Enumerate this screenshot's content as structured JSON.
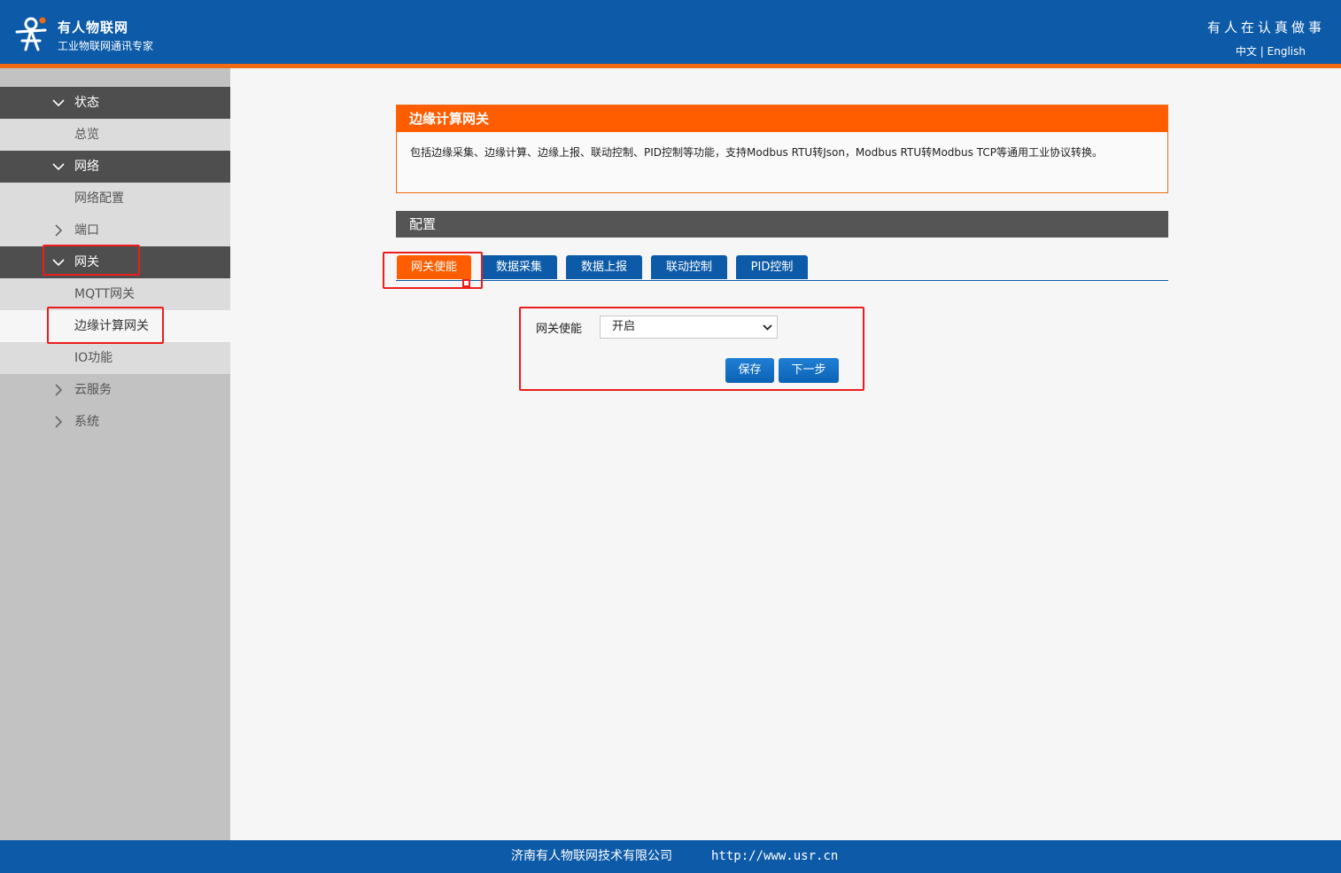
{
  "header": {
    "brand_name": "有人物联网",
    "brand_sub": "工业物联网通讯专家",
    "slogan": "有人在认真做事",
    "lang_cn": "中文",
    "lang_sep": " | ",
    "lang_en": "English"
  },
  "sidebar": {
    "items": [
      {
        "label": "状态",
        "type": "parent",
        "expanded": true
      },
      {
        "label": "总览",
        "type": "child"
      },
      {
        "label": "网络",
        "type": "parent",
        "expanded": true
      },
      {
        "label": "网络配置",
        "type": "child"
      },
      {
        "label": "端口",
        "type": "collapsed"
      },
      {
        "label": "网关",
        "type": "parent",
        "expanded": true
      },
      {
        "label": "MQTT网关",
        "type": "child"
      },
      {
        "label": "边缘计算网关",
        "type": "child",
        "active": true
      },
      {
        "label": "IO功能",
        "type": "child"
      },
      {
        "label": "云服务",
        "type": "collapsed"
      },
      {
        "label": "系统",
        "type": "collapsed"
      }
    ]
  },
  "main": {
    "intro_title": "边缘计算网关",
    "intro_text": "包括边缘采集、边缘计算、边缘上报、联动控制、PID控制等功能，支持Modbus RTU转Json，Modbus RTU转Modbus TCP等通用工业协议转换。",
    "config_title": "配置",
    "tabs": [
      {
        "label": "网关使能",
        "active": true
      },
      {
        "label": "数据采集"
      },
      {
        "label": "数据上报"
      },
      {
        "label": "联动控制"
      },
      {
        "label": "PID控制"
      }
    ],
    "gateway_enable_label": "网关使能",
    "gateway_enable_value": "开启",
    "save_label": "保存",
    "next_label": "下一步"
  },
  "footer": {
    "company": "济南有人物联网技术有限公司",
    "url": "http://www.usr.cn"
  },
  "colors": {
    "header_blue": "#0d5ba8",
    "accent_orange": "#ff5d00",
    "annotation_red": "#ee1c1c"
  },
  "icons": [
    "usr-logo-icon",
    "chevron-down-icon",
    "chevron-right-icon"
  ]
}
